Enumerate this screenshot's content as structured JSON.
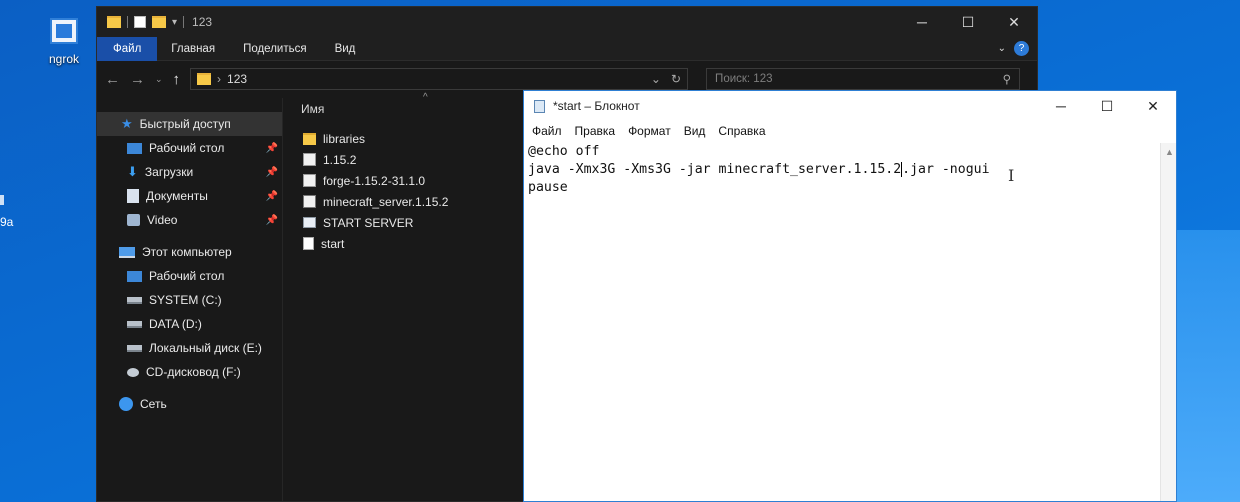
{
  "desktop": {
    "icon_label": "ngrok",
    "edge_text": "9a"
  },
  "explorer": {
    "title": "123",
    "ribbon_tabs": [
      "Файл",
      "Главная",
      "Поделиться",
      "Вид"
    ],
    "address": "123",
    "search_placeholder": "Поиск: 123",
    "column_name": "Имя",
    "nav_items": [
      {
        "label": "Быстрый доступ",
        "icon": "star-icon",
        "pinned": false
      },
      {
        "label": "Рабочий стол",
        "icon": "desktop-icon",
        "pinned": true
      },
      {
        "label": "Загрузки",
        "icon": "download-icon",
        "pinned": true
      },
      {
        "label": "Документы",
        "icon": "documents-icon",
        "pinned": true
      },
      {
        "label": "Video",
        "icon": "video-icon",
        "pinned": true
      },
      {
        "label": "Этот компьютер",
        "icon": "computer-icon",
        "pinned": false
      },
      {
        "label": "Рабочий стол",
        "icon": "desktop-icon",
        "pinned": false
      },
      {
        "label": "SYSTEM (C:)",
        "icon": "drive-icon",
        "pinned": false
      },
      {
        "label": "DATA (D:)",
        "icon": "drive-icon",
        "pinned": false
      },
      {
        "label": "Локальный диск (E:)",
        "icon": "drive-icon",
        "pinned": false
      },
      {
        "label": "CD-дисковод (F:)",
        "icon": "cd-drive-icon",
        "pinned": false
      },
      {
        "label": "Сеть",
        "icon": "network-icon",
        "pinned": false
      }
    ],
    "files": [
      {
        "name": "libraries",
        "icon": "folder-icon"
      },
      {
        "name": "1.15.2",
        "icon": "jar-file-icon"
      },
      {
        "name": "forge-1.15.2-31.1.0",
        "icon": "jar-file-icon"
      },
      {
        "name": "minecraft_server.1.15.2",
        "icon": "jar-file-icon"
      },
      {
        "name": "START SERVER",
        "icon": "batch-file-icon"
      },
      {
        "name": "start",
        "icon": "text-file-icon"
      }
    ]
  },
  "notepad": {
    "title": "*start – Блокнот",
    "menu": [
      "Файл",
      "Правка",
      "Формат",
      "Вид",
      "Справка"
    ],
    "lines": [
      "@echo off",
      "java -Xmx3G -Xms3G -jar minecraft_server.1.15.2",
      ".jar -nogui",
      "pause"
    ]
  }
}
